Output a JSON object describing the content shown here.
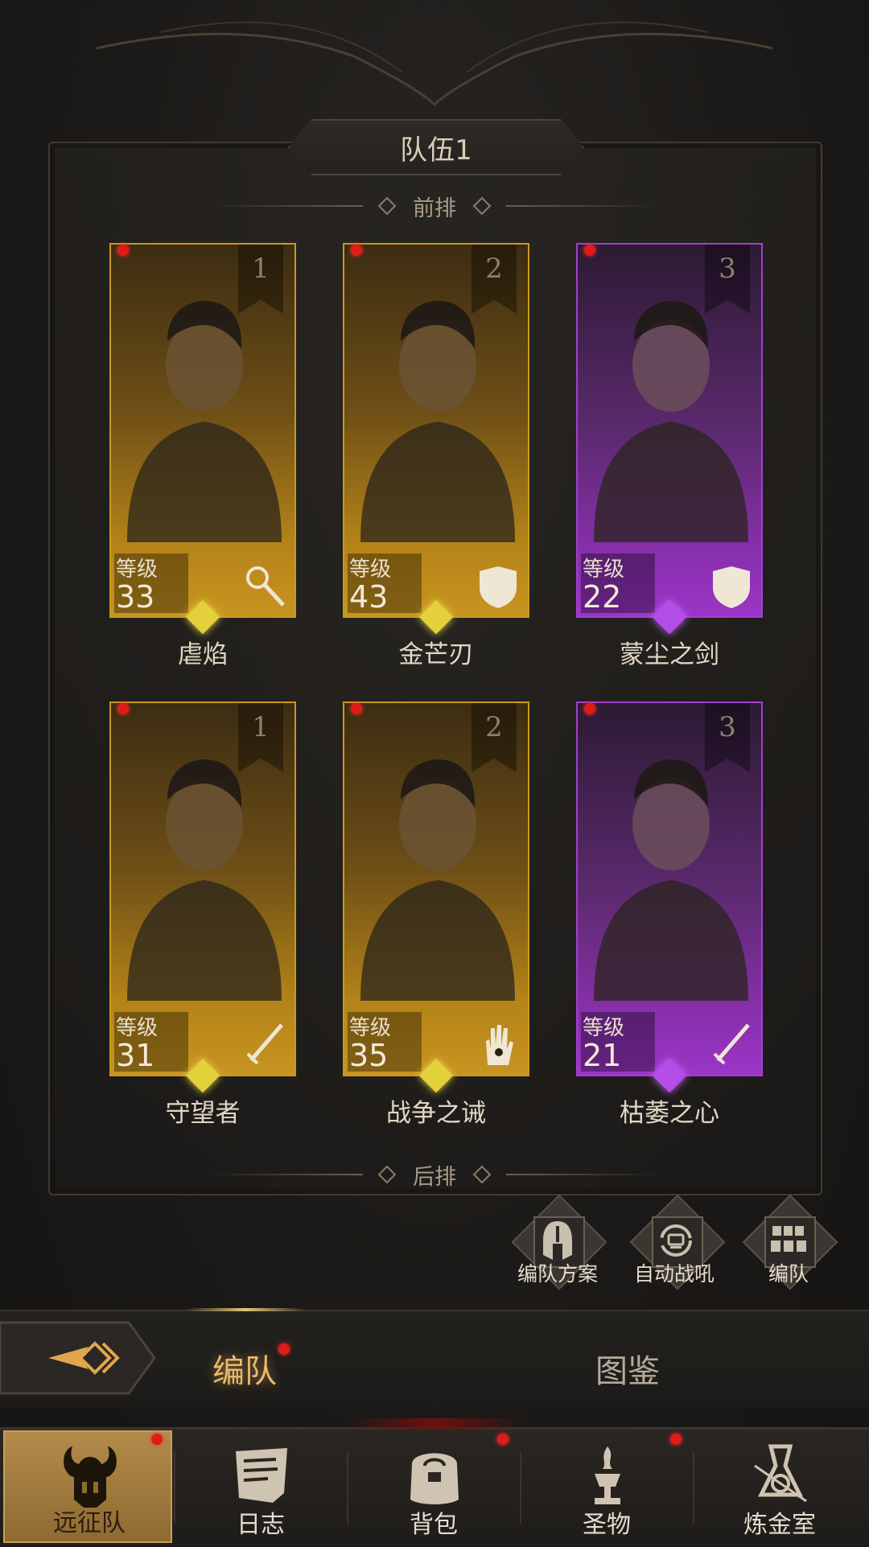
{
  "team": {
    "title": "队伍1"
  },
  "rows": {
    "front": "前排",
    "back": "后排"
  },
  "level_label": "等级",
  "heroes": [
    {
      "slot": "1",
      "name": "虐焰",
      "level": "33",
      "rarity": "gold",
      "role": "staff-icon",
      "notify": true
    },
    {
      "slot": "2",
      "name": "金芒刃",
      "level": "43",
      "rarity": "gold",
      "role": "shield-icon",
      "notify": true
    },
    {
      "slot": "3",
      "name": "蒙尘之剑",
      "level": "22",
      "rarity": "purple",
      "role": "shield-icon",
      "notify": true
    },
    {
      "slot": "1",
      "name": "守望者",
      "level": "31",
      "rarity": "gold",
      "role": "sword-icon",
      "notify": true
    },
    {
      "slot": "2",
      "name": "战争之诫",
      "level": "35",
      "rarity": "gold",
      "role": "hand-icon",
      "notify": true
    },
    {
      "slot": "3",
      "name": "枯萎之心",
      "level": "21",
      "rarity": "purple",
      "role": "sword-icon",
      "notify": true
    }
  ],
  "actions": {
    "plan": "编队方案",
    "auto_roar": "自动战吼",
    "formation": "编队"
  },
  "tabs": {
    "formation": "编队",
    "codex": "图鉴"
  },
  "nav": [
    {
      "label": "远征队",
      "icon": "helmet-icon",
      "active": true,
      "notify": true
    },
    {
      "label": "日志",
      "icon": "scroll-icon",
      "active": false,
      "notify": false
    },
    {
      "label": "背包",
      "icon": "bag-icon",
      "active": false,
      "notify": true
    },
    {
      "label": "圣物",
      "icon": "relic-icon",
      "active": false,
      "notify": true
    },
    {
      "label": "炼金室",
      "icon": "alchemy-icon",
      "active": false,
      "notify": false
    }
  ],
  "colors": {
    "gold": "#c9991f",
    "purple": "#a040d0",
    "active_tab": "#e9b96a",
    "notify": "#e01b1b"
  }
}
